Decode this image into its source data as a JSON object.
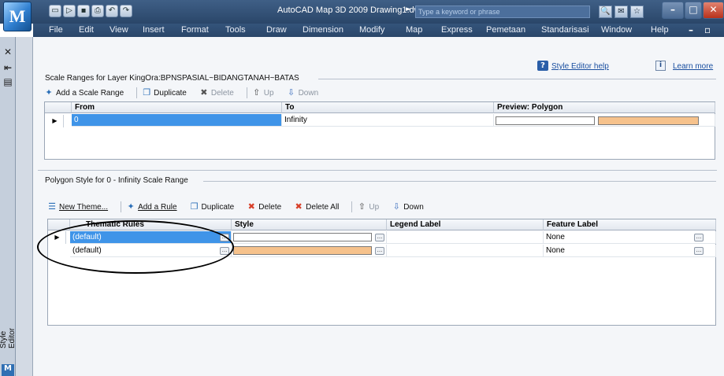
{
  "window": {
    "title": "AutoCAD Map 3D 2009  Drawing1.dwg",
    "search_placeholder": "Type a keyword or phrase",
    "app_logo": "M"
  },
  "menu": [
    "File",
    "Edit",
    "View",
    "Insert",
    "Format",
    "Tools",
    "Draw",
    "Dimension",
    "Modify",
    "Map",
    "Express",
    "Pemetaan",
    "Standarisasi",
    "Window",
    "Help"
  ],
  "palette": {
    "vertical_title": "Style Editor",
    "logo": "M"
  },
  "links": {
    "help": "Style Editor help",
    "learn": "Learn more"
  },
  "scale_section": {
    "title": "Scale Ranges for Layer KingOra:BPNSPASIAL~BIDANGTANAH~BATAS",
    "toolbar": {
      "add": "Add a Scale Range",
      "duplicate": "Duplicate",
      "delete": "Delete",
      "up": "Up",
      "down": "Down"
    },
    "columns": [
      "From",
      "To",
      "Preview: Polygon"
    ],
    "rows": [
      {
        "from": "0",
        "to": "Infinity"
      }
    ]
  },
  "polygon_section": {
    "title": "Polygon Style for 0 - Infinity Scale Range",
    "toolbar": {
      "new_theme": "New Theme...",
      "add_rule": "Add a Rule",
      "duplicate": "Duplicate",
      "delete": "Delete",
      "delete_all": "Delete All",
      "up": "Up",
      "down": "Down"
    },
    "columns": [
      "Thematic Rules",
      "Style",
      "Legend Label",
      "Feature Label"
    ],
    "rows": [
      {
        "rule": "(default)",
        "legend": "",
        "feature": "None"
      },
      {
        "rule": "(default)",
        "legend": "",
        "feature": "None"
      }
    ]
  },
  "colors": {
    "fill_orange": "#f6c28c",
    "selection_blue": "#3f94e8"
  }
}
